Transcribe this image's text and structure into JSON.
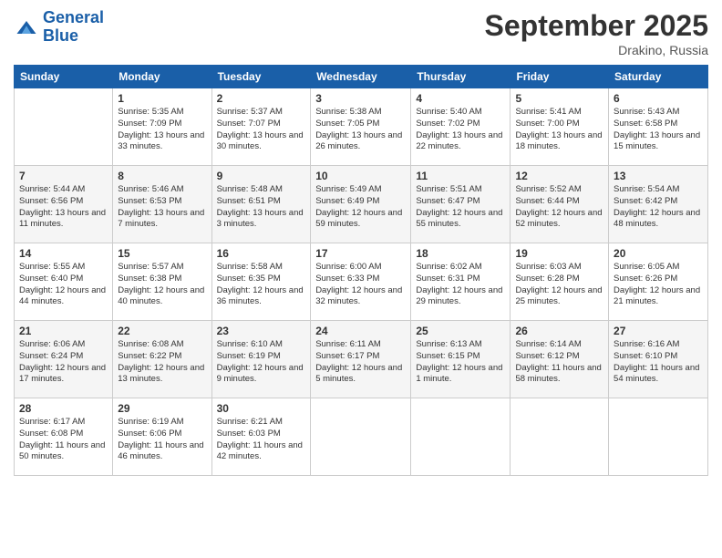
{
  "header": {
    "logo_line1": "General",
    "logo_line2": "Blue",
    "month_title": "September 2025",
    "location": "Drakino, Russia"
  },
  "weekdays": [
    "Sunday",
    "Monday",
    "Tuesday",
    "Wednesday",
    "Thursday",
    "Friday",
    "Saturday"
  ],
  "weeks": [
    [
      {
        "day": "",
        "sunrise": "",
        "sunset": "",
        "daylight": ""
      },
      {
        "day": "1",
        "sunrise": "Sunrise: 5:35 AM",
        "sunset": "Sunset: 7:09 PM",
        "daylight": "Daylight: 13 hours and 33 minutes."
      },
      {
        "day": "2",
        "sunrise": "Sunrise: 5:37 AM",
        "sunset": "Sunset: 7:07 PM",
        "daylight": "Daylight: 13 hours and 30 minutes."
      },
      {
        "day": "3",
        "sunrise": "Sunrise: 5:38 AM",
        "sunset": "Sunset: 7:05 PM",
        "daylight": "Daylight: 13 hours and 26 minutes."
      },
      {
        "day": "4",
        "sunrise": "Sunrise: 5:40 AM",
        "sunset": "Sunset: 7:02 PM",
        "daylight": "Daylight: 13 hours and 22 minutes."
      },
      {
        "day": "5",
        "sunrise": "Sunrise: 5:41 AM",
        "sunset": "Sunset: 7:00 PM",
        "daylight": "Daylight: 13 hours and 18 minutes."
      },
      {
        "day": "6",
        "sunrise": "Sunrise: 5:43 AM",
        "sunset": "Sunset: 6:58 PM",
        "daylight": "Daylight: 13 hours and 15 minutes."
      }
    ],
    [
      {
        "day": "7",
        "sunrise": "Sunrise: 5:44 AM",
        "sunset": "Sunset: 6:56 PM",
        "daylight": "Daylight: 13 hours and 11 minutes."
      },
      {
        "day": "8",
        "sunrise": "Sunrise: 5:46 AM",
        "sunset": "Sunset: 6:53 PM",
        "daylight": "Daylight: 13 hours and 7 minutes."
      },
      {
        "day": "9",
        "sunrise": "Sunrise: 5:48 AM",
        "sunset": "Sunset: 6:51 PM",
        "daylight": "Daylight: 13 hours and 3 minutes."
      },
      {
        "day": "10",
        "sunrise": "Sunrise: 5:49 AM",
        "sunset": "Sunset: 6:49 PM",
        "daylight": "Daylight: 12 hours and 59 minutes."
      },
      {
        "day": "11",
        "sunrise": "Sunrise: 5:51 AM",
        "sunset": "Sunset: 6:47 PM",
        "daylight": "Daylight: 12 hours and 55 minutes."
      },
      {
        "day": "12",
        "sunrise": "Sunrise: 5:52 AM",
        "sunset": "Sunset: 6:44 PM",
        "daylight": "Daylight: 12 hours and 52 minutes."
      },
      {
        "day": "13",
        "sunrise": "Sunrise: 5:54 AM",
        "sunset": "Sunset: 6:42 PM",
        "daylight": "Daylight: 12 hours and 48 minutes."
      }
    ],
    [
      {
        "day": "14",
        "sunrise": "Sunrise: 5:55 AM",
        "sunset": "Sunset: 6:40 PM",
        "daylight": "Daylight: 12 hours and 44 minutes."
      },
      {
        "day": "15",
        "sunrise": "Sunrise: 5:57 AM",
        "sunset": "Sunset: 6:38 PM",
        "daylight": "Daylight: 12 hours and 40 minutes."
      },
      {
        "day": "16",
        "sunrise": "Sunrise: 5:58 AM",
        "sunset": "Sunset: 6:35 PM",
        "daylight": "Daylight: 12 hours and 36 minutes."
      },
      {
        "day": "17",
        "sunrise": "Sunrise: 6:00 AM",
        "sunset": "Sunset: 6:33 PM",
        "daylight": "Daylight: 12 hours and 32 minutes."
      },
      {
        "day": "18",
        "sunrise": "Sunrise: 6:02 AM",
        "sunset": "Sunset: 6:31 PM",
        "daylight": "Daylight: 12 hours and 29 minutes."
      },
      {
        "day": "19",
        "sunrise": "Sunrise: 6:03 AM",
        "sunset": "Sunset: 6:28 PM",
        "daylight": "Daylight: 12 hours and 25 minutes."
      },
      {
        "day": "20",
        "sunrise": "Sunrise: 6:05 AM",
        "sunset": "Sunset: 6:26 PM",
        "daylight": "Daylight: 12 hours and 21 minutes."
      }
    ],
    [
      {
        "day": "21",
        "sunrise": "Sunrise: 6:06 AM",
        "sunset": "Sunset: 6:24 PM",
        "daylight": "Daylight: 12 hours and 17 minutes."
      },
      {
        "day": "22",
        "sunrise": "Sunrise: 6:08 AM",
        "sunset": "Sunset: 6:22 PM",
        "daylight": "Daylight: 12 hours and 13 minutes."
      },
      {
        "day": "23",
        "sunrise": "Sunrise: 6:10 AM",
        "sunset": "Sunset: 6:19 PM",
        "daylight": "Daylight: 12 hours and 9 minutes."
      },
      {
        "day": "24",
        "sunrise": "Sunrise: 6:11 AM",
        "sunset": "Sunset: 6:17 PM",
        "daylight": "Daylight: 12 hours and 5 minutes."
      },
      {
        "day": "25",
        "sunrise": "Sunrise: 6:13 AM",
        "sunset": "Sunset: 6:15 PM",
        "daylight": "Daylight: 12 hours and 1 minute."
      },
      {
        "day": "26",
        "sunrise": "Sunrise: 6:14 AM",
        "sunset": "Sunset: 6:12 PM",
        "daylight": "Daylight: 11 hours and 58 minutes."
      },
      {
        "day": "27",
        "sunrise": "Sunrise: 6:16 AM",
        "sunset": "Sunset: 6:10 PM",
        "daylight": "Daylight: 11 hours and 54 minutes."
      }
    ],
    [
      {
        "day": "28",
        "sunrise": "Sunrise: 6:17 AM",
        "sunset": "Sunset: 6:08 PM",
        "daylight": "Daylight: 11 hours and 50 minutes."
      },
      {
        "day": "29",
        "sunrise": "Sunrise: 6:19 AM",
        "sunset": "Sunset: 6:06 PM",
        "daylight": "Daylight: 11 hours and 46 minutes."
      },
      {
        "day": "30",
        "sunrise": "Sunrise: 6:21 AM",
        "sunset": "Sunset: 6:03 PM",
        "daylight": "Daylight: 11 hours and 42 minutes."
      },
      {
        "day": "",
        "sunrise": "",
        "sunset": "",
        "daylight": ""
      },
      {
        "day": "",
        "sunrise": "",
        "sunset": "",
        "daylight": ""
      },
      {
        "day": "",
        "sunrise": "",
        "sunset": "",
        "daylight": ""
      },
      {
        "day": "",
        "sunrise": "",
        "sunset": "",
        "daylight": ""
      }
    ]
  ]
}
